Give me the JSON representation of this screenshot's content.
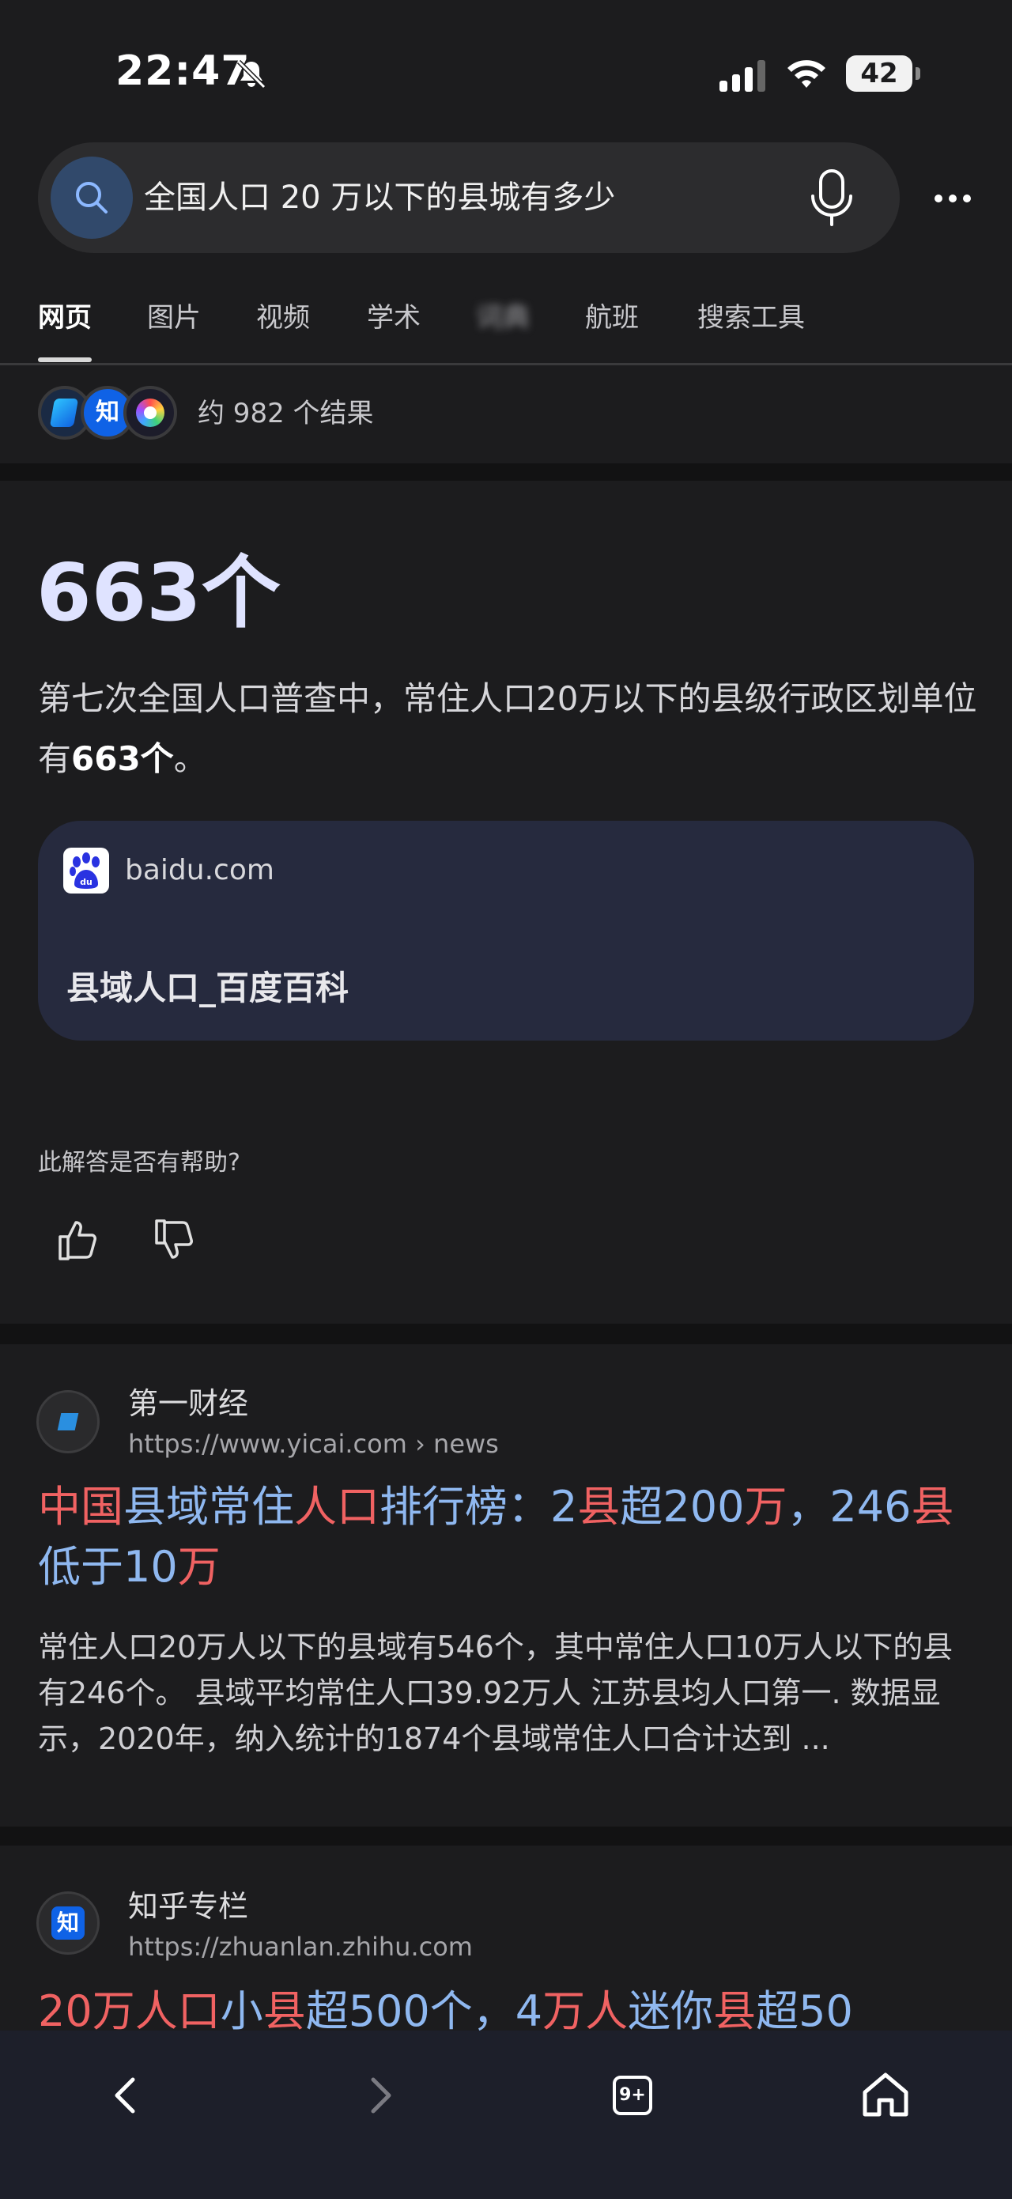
{
  "status": {
    "time": "22:47",
    "battery": "42"
  },
  "search": {
    "query": "全国人口 20 万以下的县城有多少"
  },
  "tabs": [
    {
      "label": "网页",
      "active": true
    },
    {
      "label": "图片"
    },
    {
      "label": "视频"
    },
    {
      "label": "学术"
    },
    {
      "label": "词典"
    },
    {
      "label": "航班"
    },
    {
      "label": "搜索工具"
    }
  ],
  "result_count": "约 982 个结果",
  "source_badges": [
    "bing-copilot-icon",
    "zhihu-icon",
    "baidu-color-icon"
  ],
  "answer": {
    "big": "663个",
    "desc_prefix": "第七次全国人口普查中，常住人口20万以下的县级行政区划单位有",
    "desc_bold": "663个",
    "desc_suffix": "。",
    "source_domain": "baidu.com",
    "source_title": "县域人口_百度百科",
    "helpful_question": "此解答是否有帮助?"
  },
  "results": [
    {
      "site_name": "第一财经",
      "url": "https://www.yicai.com › news",
      "title_parts": [
        {
          "text": "中国",
          "hl": true
        },
        {
          "text": "县域常住",
          "hl": false
        },
        {
          "text": "人口",
          "hl": true
        },
        {
          "text": "排行榜：2",
          "hl": false
        },
        {
          "text": "县",
          "hl": true
        },
        {
          "text": "超200",
          "hl": false
        },
        {
          "text": "万",
          "hl": true
        },
        {
          "text": "，246",
          "hl": false
        },
        {
          "text": "县",
          "hl": true
        },
        {
          "text": "低于10",
          "hl": false
        },
        {
          "text": "万",
          "hl": true
        }
      ],
      "snippet": "常住人口20万人以下的县域有546个，其中常住人口10万人以下的县有246个。 县域平均常住人口39.92万人 江苏县均人口第一. 数据显示，2020年，纳入统计的1874个县域常住人口合计达到 ..."
    },
    {
      "site_name": "知乎专栏",
      "url": "https://zhuanlan.zhihu.com",
      "title_parts": [
        {
          "text": "20万人口",
          "hl": true
        },
        {
          "text": "小",
          "hl": false
        },
        {
          "text": "县",
          "hl": true
        },
        {
          "text": "超500个，4",
          "hl": false
        },
        {
          "text": "万人",
          "hl": true
        },
        {
          "text": "迷你",
          "hl": false
        },
        {
          "text": "县",
          "hl": true
        },
        {
          "text": "超50",
          "hl": false
        }
      ]
    }
  ],
  "bottom_nav": {
    "tabs_count": "9+"
  }
}
